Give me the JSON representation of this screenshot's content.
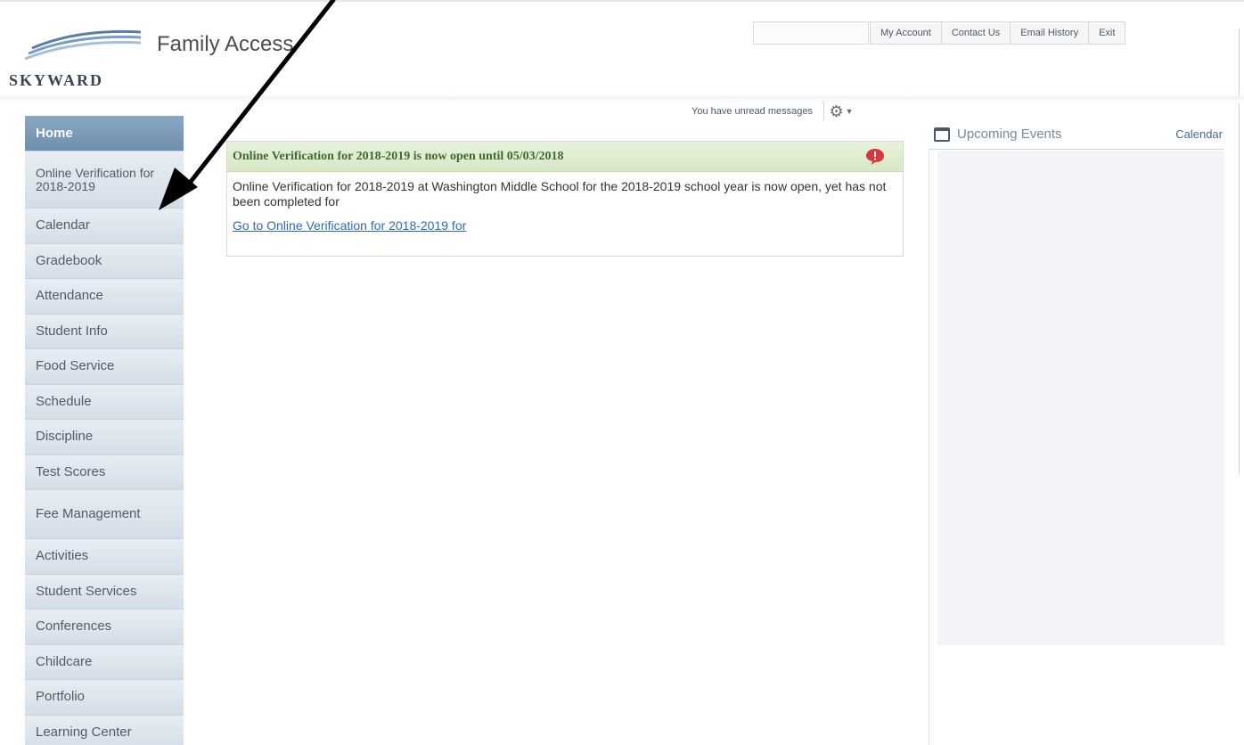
{
  "header": {
    "app_title": "Family Access",
    "logo_text": "SKYWARD",
    "links": [
      "My Account",
      "Contact Us",
      "Email History",
      "Exit"
    ]
  },
  "sidebar": {
    "items": [
      {
        "label": "Home"
      },
      {
        "label": "Online Verification for 2018-2019"
      },
      {
        "label": "Calendar"
      },
      {
        "label": "Gradebook"
      },
      {
        "label": "Attendance"
      },
      {
        "label": "Student Info"
      },
      {
        "label": "Food Service"
      },
      {
        "label": "Schedule"
      },
      {
        "label": "Discipline"
      },
      {
        "label": "Test Scores"
      },
      {
        "label": "Fee Management"
      },
      {
        "label": "Activities"
      },
      {
        "label": "Student Services"
      },
      {
        "label": "Conferences"
      },
      {
        "label": "Childcare"
      },
      {
        "label": "Portfolio"
      },
      {
        "label": "Learning Center"
      }
    ]
  },
  "main": {
    "unread_messages": "You have unread messages",
    "notice": {
      "title": "Online Verification for 2018-2019 is now open until 05/03/2018",
      "body": "Online Verification for 2018-2019 at Washington Middle School for the 2018-2019 school year is now open, yet has not been completed for",
      "link": "Go to Online Verification for 2018-2019 for"
    }
  },
  "right_panel": {
    "title": "Upcoming Events",
    "link": "Calendar"
  },
  "colors": {
    "sidebar_home": "#7896b4",
    "sidebar_bg": "#dbe4ec",
    "notice_title": "#3e6a33",
    "notice_header_bg": "#dcebcc",
    "link": "#2f68b6",
    "badge": "#d9363e"
  },
  "icons": {
    "gear": "gear-icon",
    "calendar": "calendar-icon",
    "badge": "notification-badge-icon"
  }
}
